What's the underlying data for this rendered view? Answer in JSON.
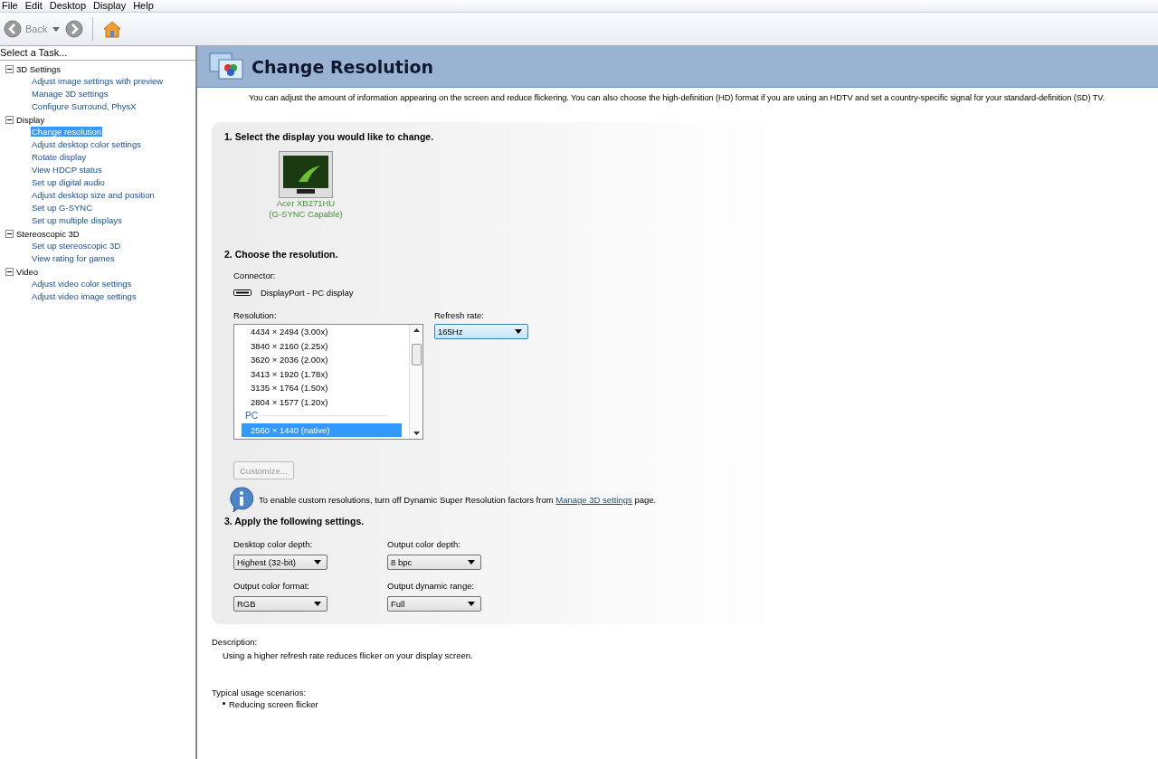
{
  "menu": [
    "File",
    "Edit",
    "Desktop",
    "Display",
    "Help"
  ],
  "toolbar": {
    "back_label": "Back"
  },
  "sidebar": {
    "title": "Select a Task...",
    "items": [
      {
        "label": "3D Settings",
        "expanded": true,
        "children": [
          {
            "label": "Adjust image settings with preview",
            "selected": false
          },
          {
            "label": "Manage 3D settings",
            "selected": false
          },
          {
            "label": "Configure Surround, PhysX",
            "selected": false
          }
        ]
      },
      {
        "label": "Display",
        "expanded": true,
        "children": [
          {
            "label": "Change resolution",
            "selected": true
          },
          {
            "label": "Adjust desktop color settings",
            "selected": false
          },
          {
            "label": "Rotate display",
            "selected": false
          },
          {
            "label": "View HDCP status",
            "selected": false
          },
          {
            "label": "Set up digital audio",
            "selected": false
          },
          {
            "label": "Adjust desktop size and position",
            "selected": false
          },
          {
            "label": "Set up G-SYNC",
            "selected": false
          },
          {
            "label": "Set up multiple displays",
            "selected": false
          }
        ]
      },
      {
        "label": "Stereoscopic 3D",
        "expanded": true,
        "children": [
          {
            "label": "Set up stereoscopic 3D",
            "selected": false
          },
          {
            "label": "View rating for games",
            "selected": false
          }
        ]
      },
      {
        "label": "Video",
        "expanded": true,
        "children": [
          {
            "label": "Adjust video color settings",
            "selected": false
          },
          {
            "label": "Adjust video image settings",
            "selected": false
          }
        ]
      }
    ]
  },
  "page": {
    "title": "Change Resolution",
    "intro": "You can adjust the amount of information appearing on the screen and reduce flickering. You can also choose the high-definition (HD) format if you are using an HDTV and set a country-specific signal for your standard-definition (SD) TV.",
    "step1": {
      "heading": "1. Select the display you would like to change.",
      "display_name": "Acer XB271HU",
      "display_note": "(G-SYNC Capable)"
    },
    "step2": {
      "heading": "2. Choose the resolution.",
      "connector_label": "Connector:",
      "connector": "DisplayPort - PC display",
      "resolution_label": "Resolution:",
      "resolutions": [
        {
          "kind": "item",
          "label": "4434 × 2494 (3.00x)",
          "selected": false
        },
        {
          "kind": "item",
          "label": "3840 × 2160 (2.25x)",
          "selected": false
        },
        {
          "kind": "item",
          "label": "3620 × 2036 (2.00x)",
          "selected": false
        },
        {
          "kind": "item",
          "label": "3413 × 1920 (1.78x)",
          "selected": false
        },
        {
          "kind": "item",
          "label": "3135 × 1764 (1.50x)",
          "selected": false
        },
        {
          "kind": "item",
          "label": "2804 × 1577 (1.20x)",
          "selected": false
        },
        {
          "kind": "group",
          "label": "PC"
        },
        {
          "kind": "item",
          "label": "2560 × 1440 (native)",
          "selected": true
        }
      ],
      "refresh_label": "Refresh rate:",
      "refresh_value": "165Hz",
      "customize": {
        "label": "Customize...",
        "disabled": true
      },
      "info_text": "To enable custom resolutions, turn off Dynamic Super Resolution factors from",
      "info_link": "Manage 3D settings",
      "info_tail": "page."
    },
    "step3": {
      "heading": "3. Apply the following settings.",
      "settings": [
        {
          "label": "Desktop color depth:",
          "value": "Highest (32-bit)"
        },
        {
          "label": "Output color depth:",
          "value": "8 bpc"
        },
        {
          "label": "Output color format:",
          "value": "RGB"
        },
        {
          "label": "Output dynamic range:",
          "value": "Full"
        }
      ]
    },
    "description_label": "Description:",
    "description": "Using a higher refresh rate reduces flicker on your display screen.",
    "usage_label": "Typical usage scenarios:",
    "usage": [
      "Reducing screen flicker"
    ]
  }
}
